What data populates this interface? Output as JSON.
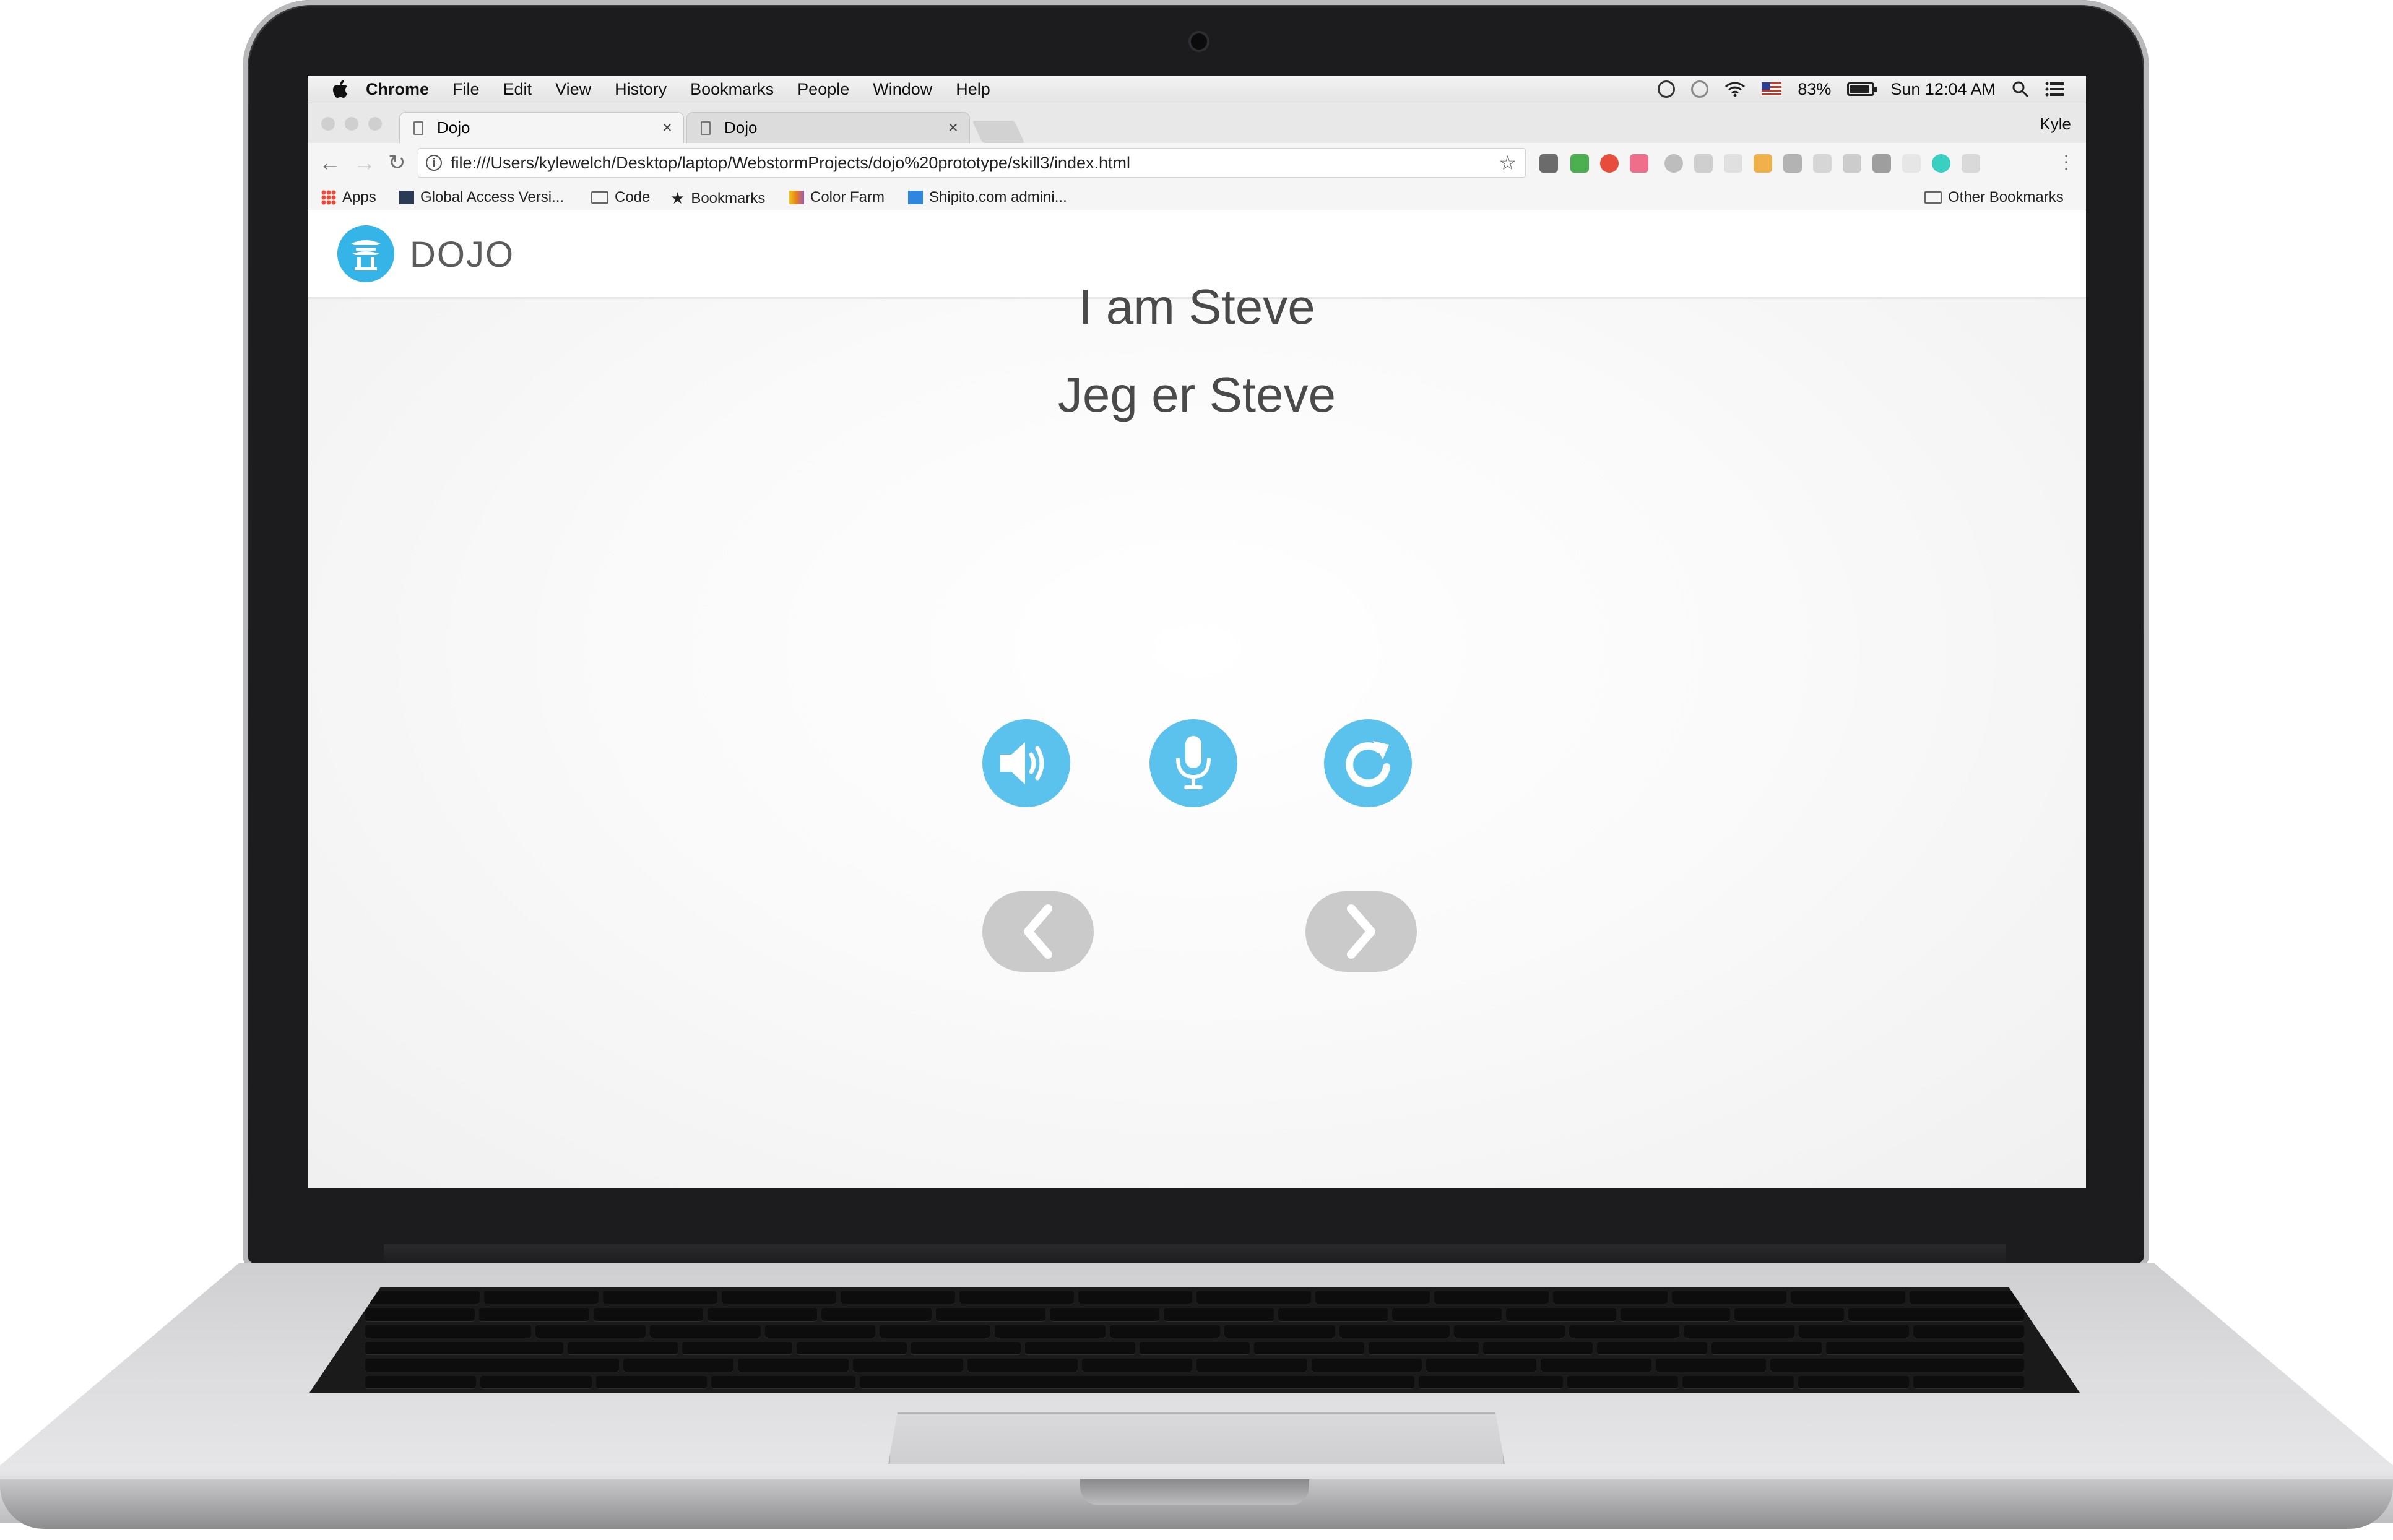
{
  "menubar": {
    "app_name": "Chrome",
    "items": [
      "File",
      "Edit",
      "View",
      "History",
      "Bookmarks",
      "People",
      "Window",
      "Help"
    ],
    "battery": "83%",
    "clock": "Sun 12:04 AM"
  },
  "tabs": [
    {
      "title": "Dojo",
      "close": "×"
    },
    {
      "title": "Dojo",
      "close": "×"
    }
  ],
  "profile_name": "Kyle",
  "omnibox": {
    "url": "file:///Users/kylewelch/Desktop/laptop/WebstormProjects/dojo%20prototype/skill3/index.html"
  },
  "bookmarks": {
    "items": [
      "Apps",
      "Global Access Versi...",
      "Code",
      "Bookmarks",
      "Color Farm",
      "Shipito.com admini..."
    ],
    "other": "Other Bookmarks"
  },
  "app": {
    "brand": "DOJO",
    "phrase_english": "I am Steve",
    "phrase_norwegian": "Jeg er Steve",
    "accent_color": "#5bc2ee",
    "nav_color": "#cacaca",
    "action_icons": [
      "speaker-icon",
      "microphone-icon",
      "refresh-icon"
    ],
    "nav_icons": [
      "chevron-left-icon",
      "chevron-right-icon"
    ]
  }
}
